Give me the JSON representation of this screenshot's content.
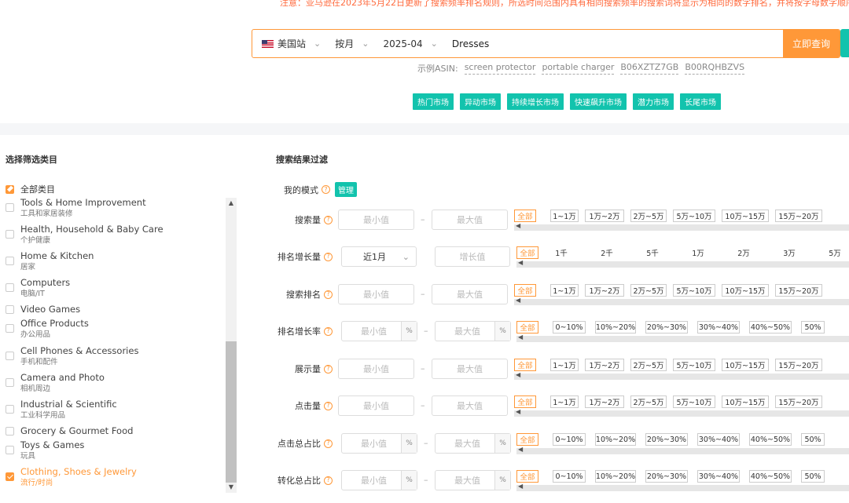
{
  "notice": "注意：亚马逊在2023年5月22日更新了搜索频率排名规则，所选时间范围内具有相同搜索频率的搜索词将显示为相同的数字排名，并将按字母数字顺序排",
  "search": {
    "site": "美国站",
    "period": "按月",
    "month": "2025-04",
    "keyword": "Dresses",
    "button": "立即查询"
  },
  "examples": {
    "label": "示例ASIN:",
    "items": [
      "screen protector",
      "portable charger",
      "B06XZTZ7GB",
      "B00RQHBZVS"
    ]
  },
  "markets": [
    "热门市场",
    "异动市场",
    "持续增长市场",
    "快速飙升市场",
    "潜力市场",
    "长尾市场"
  ],
  "category_panel": {
    "title": "选择筛选类目",
    "all_label": "全部类目",
    "items": [
      {
        "en": "Tools & Home Improvement",
        "zh": "工具和家居装修",
        "checked": false
      },
      {
        "en": "Health, Household & Baby Care",
        "zh": "个护健康",
        "checked": false
      },
      {
        "en": "Home & Kitchen",
        "zh": "居家",
        "checked": false
      },
      {
        "en": "Computers",
        "zh": "电脑/IT",
        "checked": false
      },
      {
        "en": "Video Games",
        "zh": "",
        "checked": false
      },
      {
        "en": "Office Products",
        "zh": "办公用品",
        "checked": false
      },
      {
        "en": "Cell Phones & Accessories",
        "zh": "手机和配件",
        "checked": false
      },
      {
        "en": "Camera and Photo",
        "zh": "相机周边",
        "checked": false
      },
      {
        "en": "Industrial & Scientific",
        "zh": "工业科学用品",
        "checked": false
      },
      {
        "en": "Grocery & Gourmet Food",
        "zh": "",
        "checked": false
      },
      {
        "en": "Toys & Games",
        "zh": "玩具",
        "checked": false
      },
      {
        "en": "Clothing, Shoes & Jewelry",
        "zh": "流行/时尚",
        "checked": true
      }
    ]
  },
  "filters": {
    "title": "搜索结果过滤",
    "my_mode": "我的模式",
    "manage": "管理",
    "min_placeholder": "最小值",
    "max_placeholder": "最大值",
    "growth_placeholder": "增长值",
    "growth_period": "近1月",
    "pct": "%",
    "all": "全部",
    "rows": [
      {
        "label": "搜索量",
        "kind": "range",
        "options": [
          "1~1万",
          "1万~2万",
          "2万~5万",
          "5万~10万",
          "10万~15万",
          "15万~20万"
        ]
      },
      {
        "label": "排名增长量",
        "kind": "growth",
        "options": [
          "1千",
          "2千",
          "5千",
          "1万",
          "2万",
          "3万",
          "5万"
        ]
      },
      {
        "label": "搜索排名",
        "kind": "range",
        "options": [
          "1~1万",
          "1万~2万",
          "2万~5万",
          "5万~10万",
          "10万~15万",
          "15万~20万"
        ]
      },
      {
        "label": "排名增长率",
        "kind": "pct",
        "options": [
          "0~10%",
          "10%~20%",
          "20%~30%",
          "30%~40%",
          "40%~50%",
          "50%"
        ]
      },
      {
        "label": "展示量",
        "kind": "range",
        "options": [
          "1~1万",
          "1万~2万",
          "2万~5万",
          "5万~10万",
          "10万~15万",
          "15万~20万"
        ]
      },
      {
        "label": "点击量",
        "kind": "range",
        "options": [
          "1~1万",
          "1万~2万",
          "2万~5万",
          "5万~10万",
          "10万~15万",
          "15万~20万"
        ]
      },
      {
        "label": "点击总占比",
        "kind": "pct",
        "options": [
          "0~10%",
          "10%~20%",
          "20%~30%",
          "30%~40%",
          "40%~50%",
          "50%"
        ]
      },
      {
        "label": "转化总占比",
        "kind": "pct",
        "options": [
          "0~10%",
          "10%~20%",
          "20%~30%",
          "30%~40%",
          "40%~50%",
          "50%"
        ]
      }
    ]
  },
  "colors": {
    "accent": "#ff9838",
    "teal": "#12c3ad"
  }
}
